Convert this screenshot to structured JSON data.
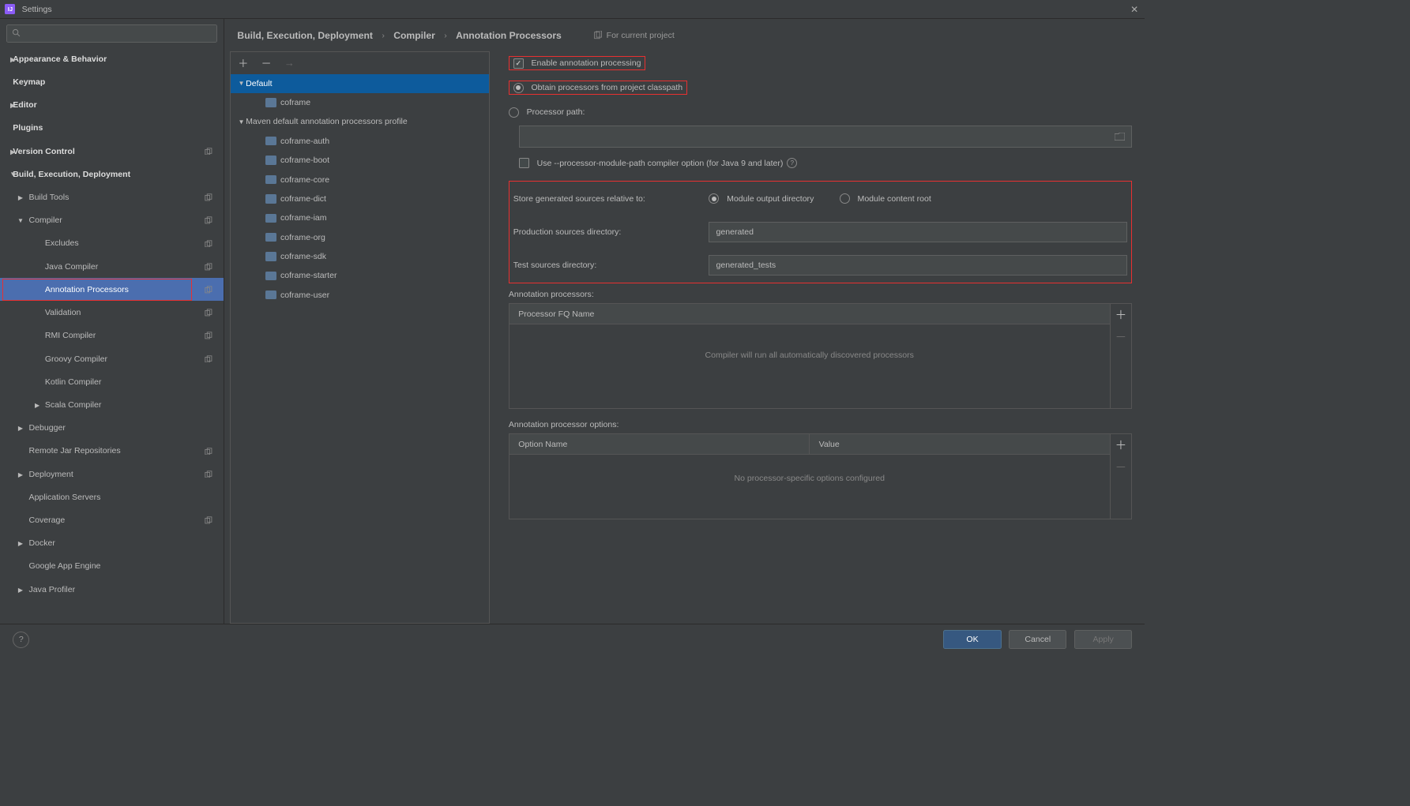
{
  "window": {
    "title": "Settings"
  },
  "search": {
    "placeholder": ""
  },
  "sidebar": {
    "items": [
      {
        "label": "Appearance & Behavior",
        "depth": 0,
        "arrow": "▶"
      },
      {
        "label": "Keymap",
        "depth": 0
      },
      {
        "label": "Editor",
        "depth": 0,
        "arrow": "▶"
      },
      {
        "label": "Plugins",
        "depth": 0
      },
      {
        "label": "Version Control",
        "depth": 0,
        "arrow": "▶",
        "copy": true
      },
      {
        "label": "Build, Execution, Deployment",
        "depth": 0,
        "arrow": "▼"
      },
      {
        "label": "Build Tools",
        "depth": 1,
        "arrow": "▶",
        "copy": true
      },
      {
        "label": "Compiler",
        "depth": 1,
        "arrow": "▼",
        "copy": true
      },
      {
        "label": "Excludes",
        "depth": 2,
        "copy": true
      },
      {
        "label": "Java Compiler",
        "depth": 2,
        "copy": true
      },
      {
        "label": "Annotation Processors",
        "depth": 2,
        "copy": true,
        "selected": true,
        "highlight": true
      },
      {
        "label": "Validation",
        "depth": 2,
        "copy": true
      },
      {
        "label": "RMI Compiler",
        "depth": 2,
        "copy": true
      },
      {
        "label": "Groovy Compiler",
        "depth": 2,
        "copy": true
      },
      {
        "label": "Kotlin Compiler",
        "depth": 2
      },
      {
        "label": "Scala Compiler",
        "depth": 2,
        "arrow": "▶"
      },
      {
        "label": "Debugger",
        "depth": 1,
        "arrow": "▶"
      },
      {
        "label": "Remote Jar Repositories",
        "depth": 1,
        "copy": true
      },
      {
        "label": "Deployment",
        "depth": 1,
        "arrow": "▶",
        "copy": true
      },
      {
        "label": "Application Servers",
        "depth": 1
      },
      {
        "label": "Coverage",
        "depth": 1,
        "copy": true
      },
      {
        "label": "Docker",
        "depth": 1,
        "arrow": "▶"
      },
      {
        "label": "Google App Engine",
        "depth": 1
      },
      {
        "label": "Java Profiler",
        "depth": 1,
        "arrow": "▶"
      }
    ]
  },
  "breadcrumb": {
    "a": "Build, Execution, Deployment",
    "b": "Compiler",
    "c": "Annotation Processors",
    "scope": "For current project"
  },
  "profiles": {
    "items": [
      {
        "label": "Default",
        "depth": 0,
        "arrow": "▼",
        "selected": true
      },
      {
        "label": "coframe",
        "depth": 1,
        "folder": true
      },
      {
        "label": "Maven default annotation processors profile",
        "depth": 0,
        "arrow": "▼"
      },
      {
        "label": "coframe-auth",
        "depth": 1,
        "folder": true
      },
      {
        "label": "coframe-boot",
        "depth": 1,
        "folder": true
      },
      {
        "label": "coframe-core",
        "depth": 1,
        "folder": true
      },
      {
        "label": "coframe-dict",
        "depth": 1,
        "folder": true
      },
      {
        "label": "coframe-iam",
        "depth": 1,
        "folder": true
      },
      {
        "label": "coframe-org",
        "depth": 1,
        "folder": true
      },
      {
        "label": "coframe-sdk",
        "depth": 1,
        "folder": true
      },
      {
        "label": "coframe-starter",
        "depth": 1,
        "folder": true
      },
      {
        "label": "coframe-user",
        "depth": 1,
        "folder": true
      }
    ]
  },
  "form": {
    "enable_label": "Enable annotation processing",
    "obtain_label": "Obtain processors from project classpath",
    "path_label": "Processor path:",
    "path_value": "",
    "module_path_label": "Use --processor-module-path compiler option (for Java 9 and later)",
    "store_label": "Store generated sources relative to:",
    "store_opt1": "Module output directory",
    "store_opt2": "Module content root",
    "prod_label": "Production sources directory:",
    "prod_value": "generated",
    "test_label": "Test sources directory:",
    "test_value": "generated_tests",
    "ap_header": "Annotation processors:",
    "ap_col": "Processor FQ Name",
    "ap_empty": "Compiler will run all automatically discovered processors",
    "opt_header": "Annotation processor options:",
    "opt_col1": "Option Name",
    "opt_col2": "Value",
    "opt_empty": "No processor-specific options configured"
  },
  "buttons": {
    "ok": "OK",
    "cancel": "Cancel",
    "apply": "Apply"
  }
}
